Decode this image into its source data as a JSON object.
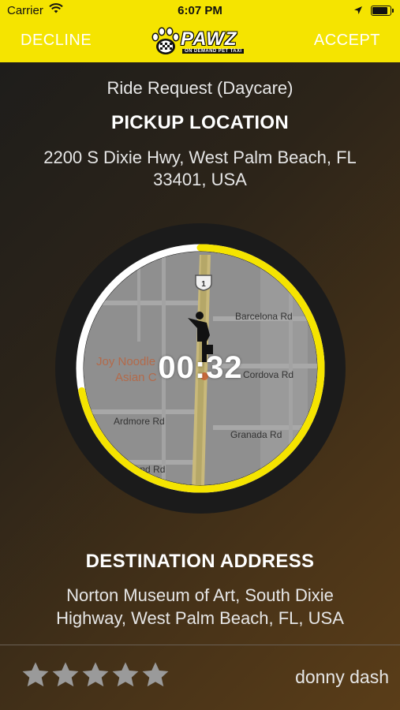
{
  "status_bar": {
    "carrier": "Carrier",
    "time": "6:07 PM"
  },
  "nav": {
    "decline_label": "DECLINE",
    "accept_label": "ACCEPT",
    "logo_text": "PAWZ",
    "logo_tagline": "ON DEMAND PET TAXI"
  },
  "request": {
    "ride_type": "Ride Request (Daycare)",
    "pickup_heading": "PICKUP LOCATION",
    "pickup_address": "2200 S Dixie Hwy,  West Palm Beach,  FL 33401,  USA",
    "timer": "00:32",
    "timer_progress": 0.72,
    "destination_heading": "DESTINATION ADDRESS",
    "destination_address": "Norton Museum of Art, South Dixie Highway, West Palm Beach, FL, USA"
  },
  "map": {
    "route_shield": "1",
    "labels": {
      "barcelona": "Barcelona Rd",
      "cordova": "Cordova Rd",
      "ardmore": "Ardmore Rd",
      "granada": "Granada Rd",
      "poi_line1": "Joy Noodle",
      "poi_line2": "Asian C",
      "partial": "land Rd"
    }
  },
  "driver": {
    "name": "donny dash",
    "rating": 5,
    "rating_max": 5
  },
  "colors": {
    "brand_yellow": "#f5e400",
    "star": "#9a9a9a"
  }
}
